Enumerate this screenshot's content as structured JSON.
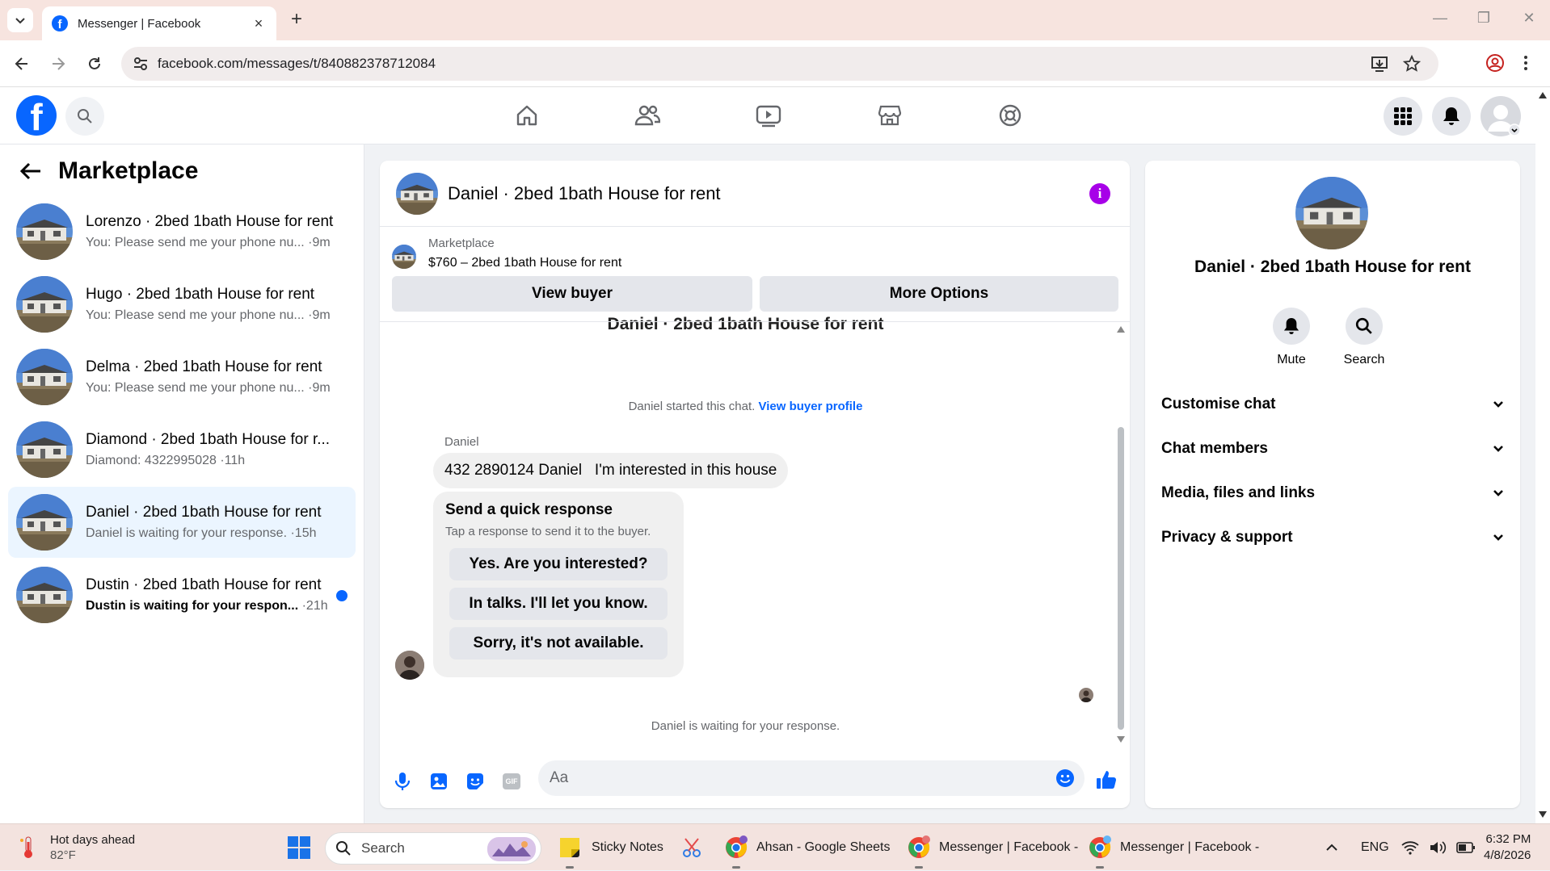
{
  "browser": {
    "tab_title": "Messenger | Facebook",
    "url": "facebook.com/messages/t/840882378712084",
    "new_tab": "+",
    "close_tab": "×"
  },
  "left": {
    "title": "Marketplace",
    "conversations": [
      {
        "name": "Lorenzo · 2bed 1bath House for rent",
        "preview": "You: Please send me your phone nu...",
        "time": "·9m"
      },
      {
        "name": "Hugo · 2bed 1bath House for rent",
        "preview": "You: Please send me your phone nu...",
        "time": "·9m"
      },
      {
        "name": "Delma · 2bed 1bath House for rent",
        "preview": "You: Please send me your phone nu...",
        "time": "·9m"
      },
      {
        "name": "Diamond · 2bed 1bath House for r...",
        "preview": "Diamond: 4322995028",
        "time": "·11h"
      },
      {
        "name": "Daniel · 2bed 1bath House for rent",
        "preview": "Daniel is waiting for your response.",
        "time": "·15h"
      },
      {
        "name": "Dustin · 2bed 1bath House for rent",
        "preview": "Dustin is waiting for your respon...",
        "time": "·21h"
      }
    ]
  },
  "chat": {
    "title": "Daniel · 2bed 1bath House for rent",
    "marketplace_label": "Marketplace",
    "listing": "$760 – 2bed 1bath House for rent",
    "view_buyer": "View buyer",
    "more_options": "More Options",
    "ghost_title": "Daniel · 2bed 1bath House for rent",
    "started_text": "Daniel started this chat.",
    "view_buyer_profile": "View buyer profile",
    "sender": "Daniel",
    "message": "432 2890124 Daniel   I'm interested in this house",
    "quick_title": "Send a quick response",
    "quick_sub": "Tap a response to send it to the buyer.",
    "quick_options": [
      "Yes. Are you interested?",
      "In talks. I'll let you know.",
      "Sorry, it's not available."
    ],
    "waiting": "Daniel is waiting for your response.",
    "composer_placeholder": "Aa",
    "gif": "GIF"
  },
  "right": {
    "name": "Daniel · 2bed 1bath House for rent",
    "mute": "Mute",
    "search": "Search",
    "sections": [
      "Customise chat",
      "Chat members",
      "Media, files and links",
      "Privacy & support"
    ]
  },
  "taskbar": {
    "weather_title": "Hot days ahead",
    "weather_temp": "82°F",
    "search": "Search",
    "apps": [
      "Sticky Notes",
      "Ahsan - Google Sheets",
      "Messenger | Facebook -",
      "Messenger | Facebook -"
    ],
    "lang": "ENG",
    "time": "6:32 PM",
    "date": "4/8/2026"
  },
  "colors": {
    "accent": "#0866ff",
    "info": "#a700e8",
    "active_row": "#ebf5ff"
  }
}
